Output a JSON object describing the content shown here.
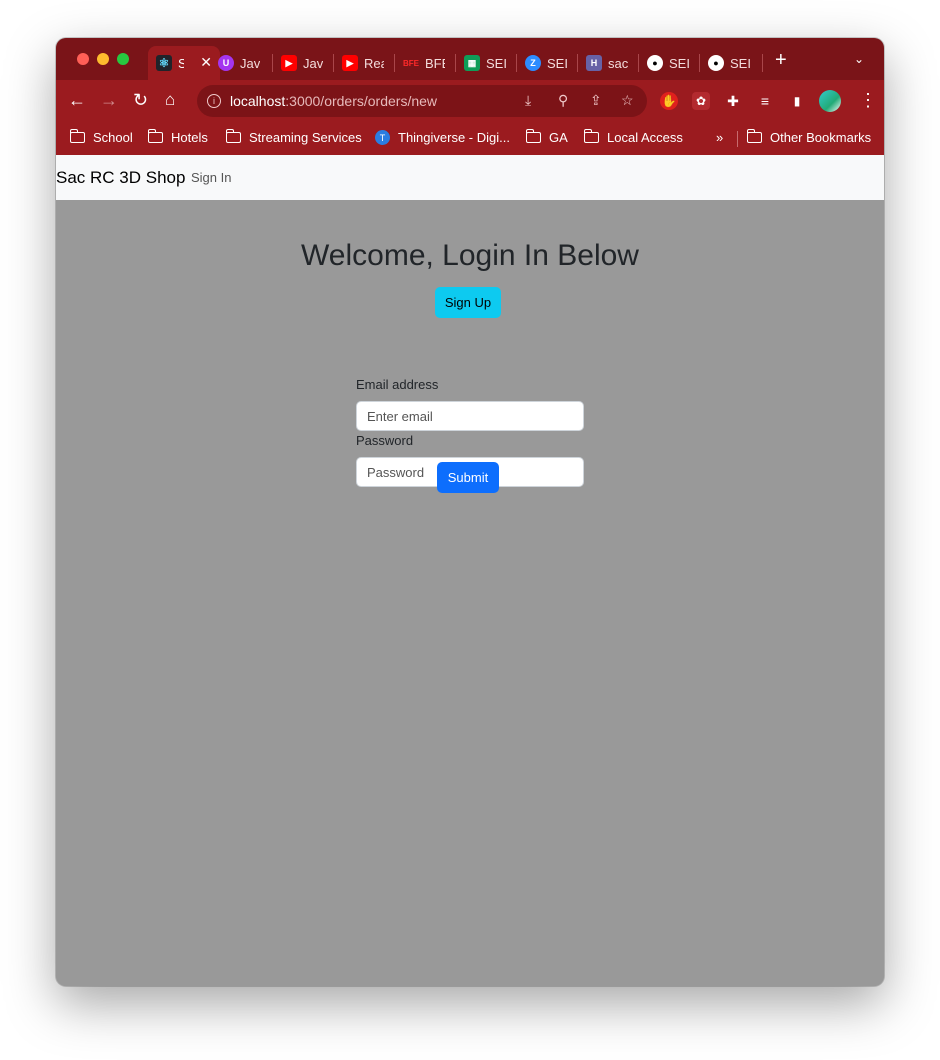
{
  "colors": {
    "tab_strip": "#7a1418",
    "toolbar": "#9b1b1f",
    "page_background": "#999999",
    "navbar_background": "#f8f9fa",
    "signup_button": "#0dcaf0",
    "submit_button": "#0d6efd"
  },
  "browser": {
    "tabs": [
      {
        "title": "S",
        "icon": "react-icon",
        "active": true
      },
      {
        "title": "Java",
        "icon": "udemy-icon"
      },
      {
        "title": "Java",
        "icon": "youtube-icon"
      },
      {
        "title": "Rea",
        "icon": "youtube-icon"
      },
      {
        "title": "BFE",
        "icon": "bfe-icon"
      },
      {
        "title": "SEI",
        "icon": "sheets-icon"
      },
      {
        "title": "SEI",
        "icon": "zoom-icon"
      },
      {
        "title": "sac",
        "icon": "heroku-icon"
      },
      {
        "title": "SEI",
        "icon": "github-icon"
      },
      {
        "title": "SEI",
        "icon": "github-icon"
      }
    ],
    "url_host": "localhost",
    "url_rest": ":3000/orders/orders/new",
    "bookmarks": [
      {
        "label": "School",
        "type": "folder"
      },
      {
        "label": "Hotels",
        "type": "folder"
      },
      {
        "label": "Streaming Services",
        "type": "folder"
      },
      {
        "label": "Thingiverse - Digi...",
        "type": "site"
      },
      {
        "label": "GA",
        "type": "folder"
      },
      {
        "label": "Local Access",
        "type": "folder"
      }
    ],
    "bookmarks_overflow": "»",
    "other_bookmarks": "Other Bookmarks"
  },
  "navbar": {
    "brand": "Sac RC 3D Shop",
    "signin_link": "Sign In"
  },
  "main": {
    "heading": "Welcome, Login In Below",
    "signup_button": "Sign Up",
    "email_label": "Email address",
    "email_placeholder": "Enter email",
    "password_label": "Password",
    "password_placeholder": "Password",
    "submit_button": "Submit"
  }
}
